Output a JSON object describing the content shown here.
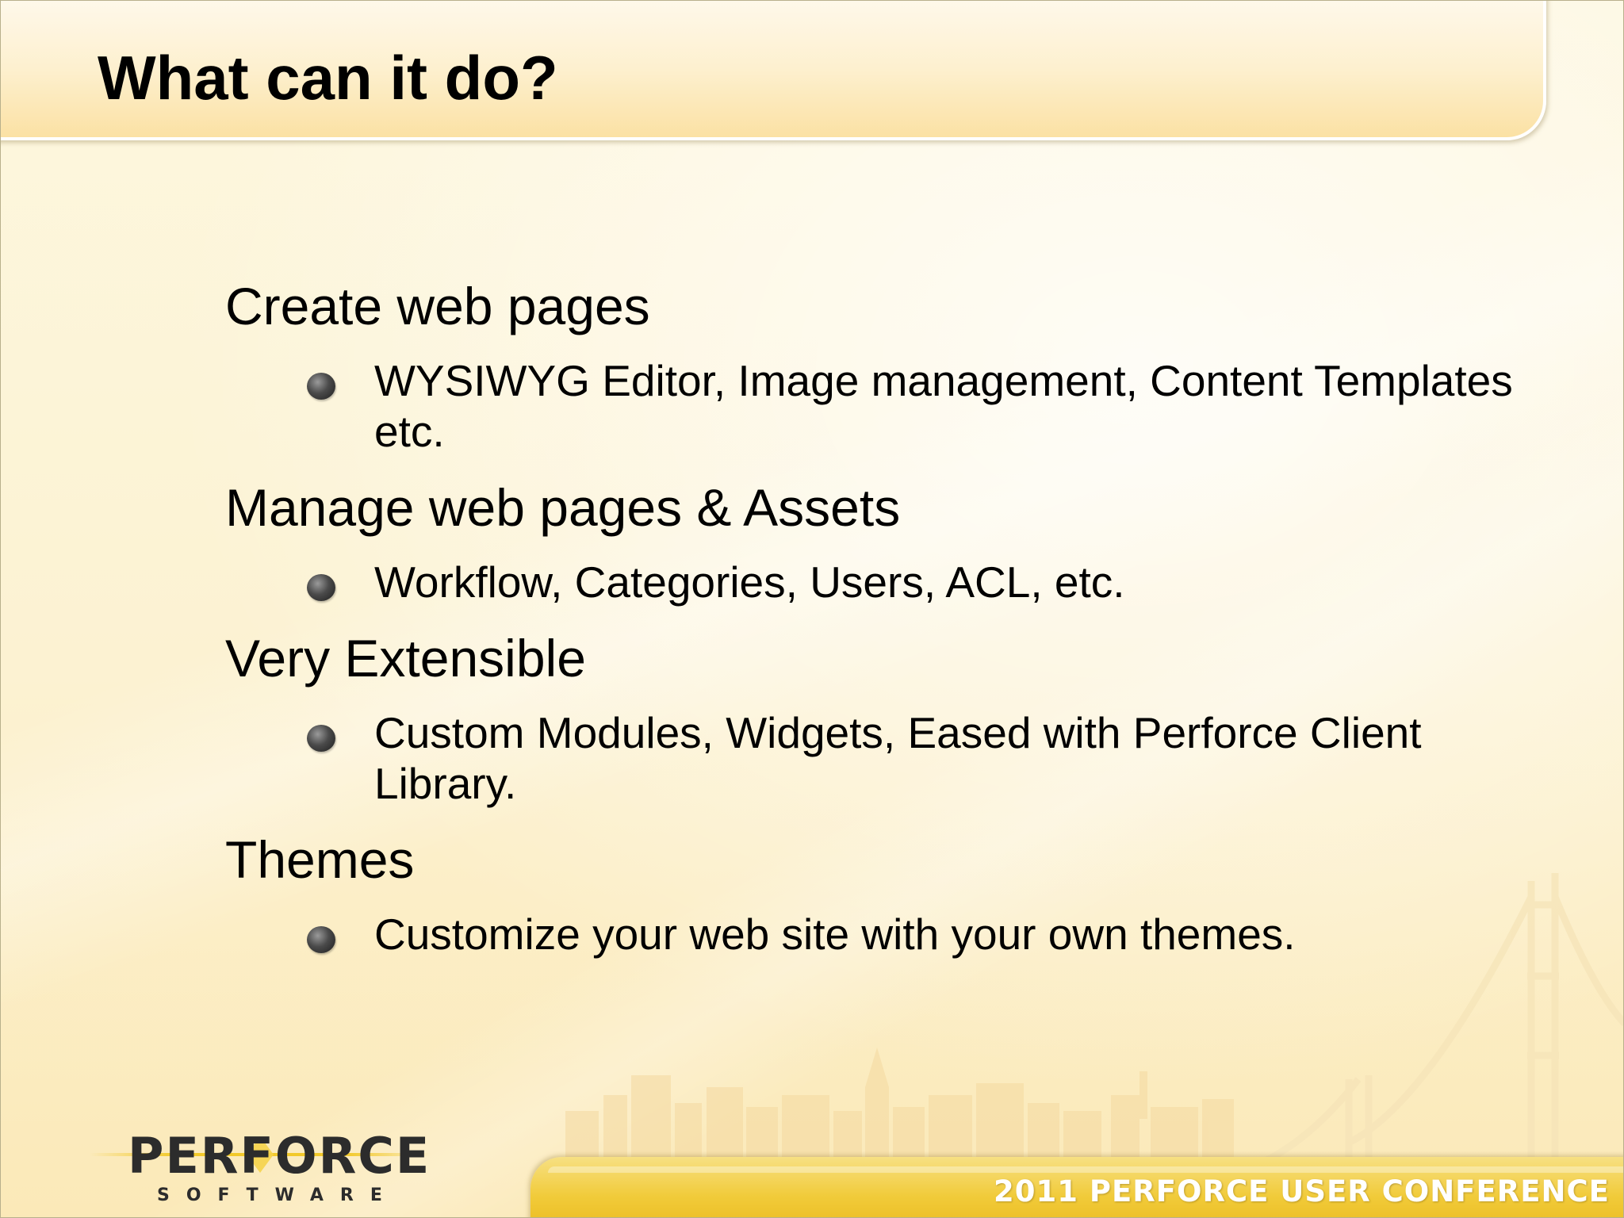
{
  "slide": {
    "title": "What can it do?",
    "sections": [
      {
        "heading": "Create web pages",
        "bullets": [
          "WYSIWYG Editor, Image management, Content Templates etc."
        ]
      },
      {
        "heading": "Manage web pages & Assets",
        "bullets": [
          "Workflow, Categories, Users, ACL, etc."
        ]
      },
      {
        "heading": "Very Extensible",
        "bullets": [
          "Custom Modules, Widgets, Eased with Perforce Client Library."
        ]
      },
      {
        "heading": "Themes",
        "bullets": [
          "Customize your web site with your own themes."
        ]
      }
    ]
  },
  "footer": {
    "logo_name": "PERFORCE",
    "logo_sub": "SOFTWARE",
    "conference": "2011 PERFORCE USER CONFERENCE"
  },
  "colors": {
    "background": "#fdf6dc",
    "footer_band": "#f1cb3a",
    "text": "#000000"
  },
  "icons": {
    "bullet": "gray-sphere-bullet",
    "logo": "perforce-logo",
    "decoration": "golden-gate-bridge-skyline"
  }
}
